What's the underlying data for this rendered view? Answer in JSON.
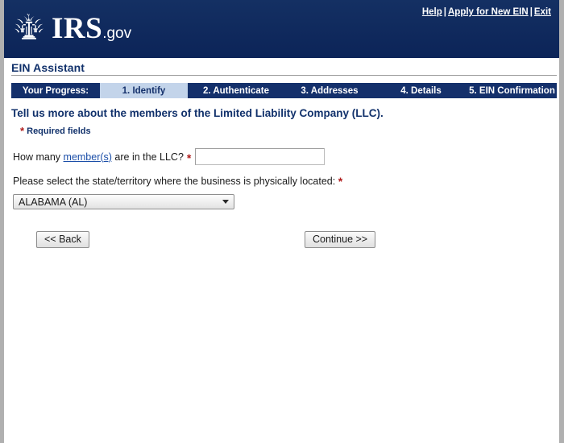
{
  "header": {
    "brand_name": "IRS",
    "brand_suffix": ".gov",
    "seal_icon": "irs-eagle-seal-icon",
    "links": [
      {
        "label": "Help",
        "name": "help-link"
      },
      {
        "label": "Apply for New EIN",
        "name": "apply-new-ein-link"
      },
      {
        "label": "Exit",
        "name": "exit-link"
      }
    ],
    "separator": "|"
  },
  "app": {
    "title": "EIN Assistant"
  },
  "progress": {
    "label": "Your Progress:",
    "steps": [
      {
        "label": "1. Identify",
        "active": true
      },
      {
        "label": "2. Authenticate",
        "active": false
      },
      {
        "label": "3. Addresses",
        "active": false
      },
      {
        "label": "4. Details",
        "active": false
      },
      {
        "label": "5. EIN Confirmation",
        "active": false
      }
    ],
    "active_bg": "#c3d4ea",
    "bar_bg": "#14306b"
  },
  "main": {
    "heading": "Tell us more about the members of the Limited Liability Company (LLC).",
    "required_note": "Required fields",
    "required_marker": "*",
    "question1": {
      "text_before": "How many ",
      "link_text": "member(s)",
      "text_after": " are in the LLC?",
      "input_value": "",
      "input_placeholder": ""
    },
    "question2": {
      "text": "Please select the state/territory where the business is physically located:",
      "selected_state": "ALABAMA (AL)",
      "dropdown_icon": "chevron-down-icon"
    }
  },
  "buttons": {
    "back_label": "<< Back",
    "continue_label": "Continue >>"
  },
  "colors": {
    "header_navy": "#0d2c60",
    "heading_blue": "#11316b",
    "link_blue": "#1b4ea8",
    "required_red": "#b01c1c"
  }
}
